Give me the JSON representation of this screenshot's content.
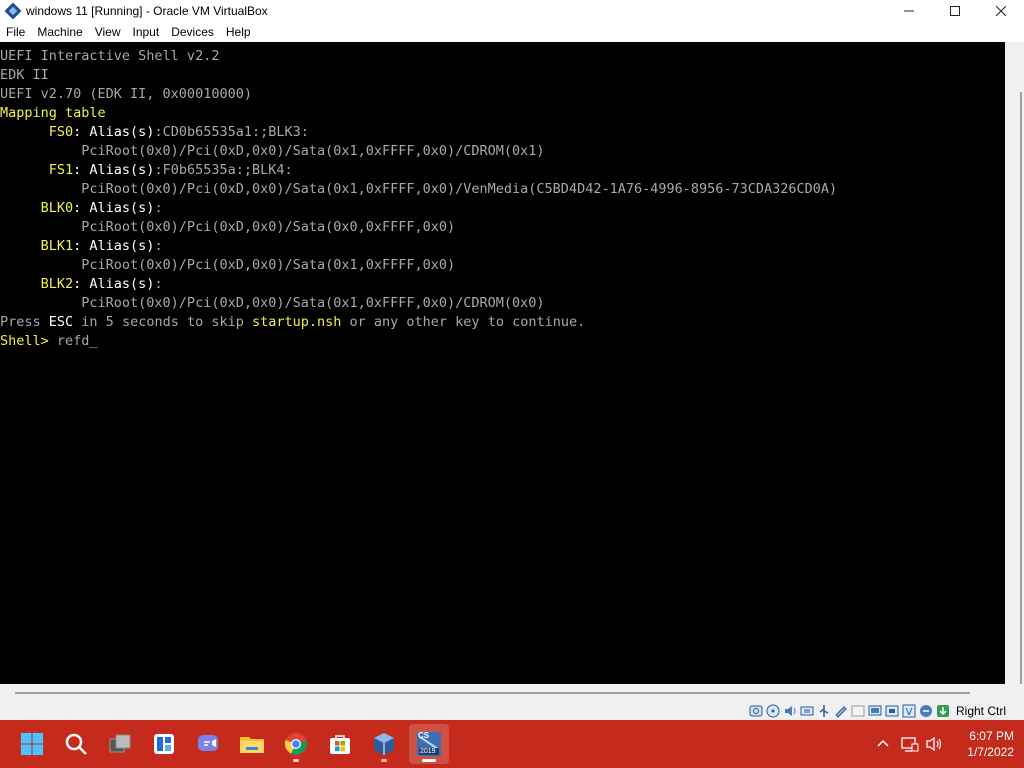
{
  "window": {
    "title": "windows 11 [Running] - Oracle VM VirtualBox",
    "controls": {
      "minimize": "—",
      "maximize": "☐",
      "close": "✕"
    }
  },
  "menubar": {
    "items": [
      "File",
      "Machine",
      "View",
      "Input",
      "Devices",
      "Help"
    ]
  },
  "console": {
    "lines": [
      [
        {
          "t": "UEFI Interactive Shell v2.2",
          "c": "g"
        }
      ],
      [
        {
          "t": "EDK II",
          "c": "g"
        }
      ],
      [
        {
          "t": "UEFI v2.70 (EDK II, 0x00010000)",
          "c": "g"
        }
      ],
      [
        {
          "t": "Mapping table",
          "c": "y"
        }
      ],
      [
        {
          "t": "      FS0",
          "c": "y"
        },
        {
          "t": ": Alias(s)",
          "c": "w"
        },
        {
          "t": ":CD0b65535a1:;BLK3:",
          "c": "g"
        }
      ],
      [
        {
          "t": "          PciRoot(0x0)/Pci(0xD,0x0)/Sata(0x1,0xFFFF,0x0)/CDROM(0x1)",
          "c": "g"
        }
      ],
      [
        {
          "t": "      FS1",
          "c": "y"
        },
        {
          "t": ": Alias(s)",
          "c": "w"
        },
        {
          "t": ":F0b65535a:;BLK4:",
          "c": "g"
        }
      ],
      [
        {
          "t": "          PciRoot(0x0)/Pci(0xD,0x0)/Sata(0x1,0xFFFF,0x0)/VenMedia(C5BD4D42-1A76-4996-8956-73CDA326CD0A)",
          "c": "g"
        }
      ],
      [
        {
          "t": "     BLK0",
          "c": "y"
        },
        {
          "t": ": Alias(s)",
          "c": "w"
        },
        {
          "t": ":",
          "c": "g"
        }
      ],
      [
        {
          "t": "          PciRoot(0x0)/Pci(0xD,0x0)/Sata(0x0,0xFFFF,0x0)",
          "c": "g"
        }
      ],
      [
        {
          "t": "     BLK1",
          "c": "y"
        },
        {
          "t": ": Alias(s)",
          "c": "w"
        },
        {
          "t": ":",
          "c": "g"
        }
      ],
      [
        {
          "t": "          PciRoot(0x0)/Pci(0xD,0x0)/Sata(0x1,0xFFFF,0x0)",
          "c": "g"
        }
      ],
      [
        {
          "t": "     BLK2",
          "c": "y"
        },
        {
          "t": ": Alias(s)",
          "c": "w"
        },
        {
          "t": ":",
          "c": "g"
        }
      ],
      [
        {
          "t": "          PciRoot(0x0)/Pci(0xD,0x0)/Sata(0x1,0xFFFF,0x0)/CDROM(0x0)",
          "c": "g"
        }
      ],
      [
        {
          "t": "Press ",
          "c": "g"
        },
        {
          "t": "ESC",
          "c": "w"
        },
        {
          "t": " in 5 seconds to skip ",
          "c": "g"
        },
        {
          "t": "startup.nsh",
          "c": "y"
        },
        {
          "t": " or any other key to continue.",
          "c": "g"
        }
      ],
      [
        {
          "t": "Shell> ",
          "c": "y"
        },
        {
          "t": "refd",
          "c": "g"
        },
        {
          "t": "_",
          "c": "cursor"
        }
      ]
    ]
  },
  "statusbar": {
    "host_key": "Right Ctrl",
    "icons": [
      "hard-disk-icon",
      "optical-drive-icon",
      "audio-icon",
      "network-icon",
      "usb-icon",
      "shared-folders-icon",
      "display-icon",
      "video-capture-icon",
      "cpu-icon",
      "mouse-integration-icon",
      "guest-additions-icon"
    ]
  },
  "taskbar": {
    "apps": [
      "start-icon",
      "search-icon",
      "task-view-icon",
      "widgets-icon",
      "teams-chat-icon",
      "file-explorer-icon",
      "chrome-icon",
      "microsoft-store-icon",
      "virtualbox-icon",
      "sql-server-2019-icon"
    ],
    "sql_badge_text": "2019",
    "sql_top_text": "CS",
    "clock_time": "6:07 PM",
    "clock_date": "1/7/2022"
  },
  "colors": {
    "taskbar_bg": "#c42b1c",
    "console_bg": "#000000",
    "console_yellow": "#f2f24a",
    "console_gray": "#a8a8a8",
    "console_white": "#ffffff"
  }
}
